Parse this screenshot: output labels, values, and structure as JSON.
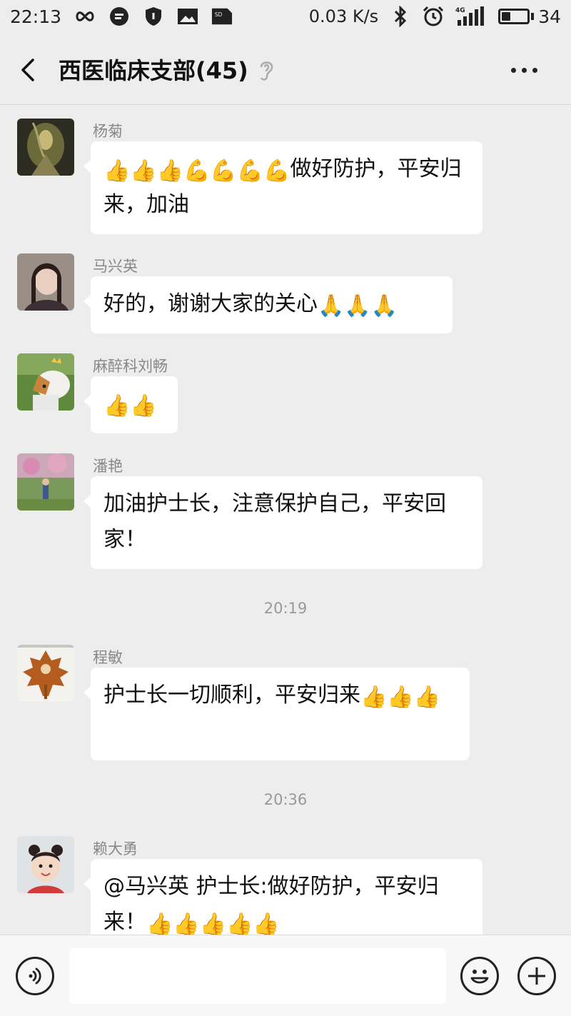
{
  "status_bar": {
    "time": "22:13",
    "network_speed": "0.03 K/s",
    "signal_type": "4G",
    "battery_level": "34",
    "battery_fraction": 0.34,
    "icons": [
      "infinity-icon",
      "message-icon",
      "shield-icon",
      "image-icon",
      "sd-card-icon",
      "bluetooth-icon",
      "alarm-icon",
      "signal-icon",
      "battery-icon"
    ]
  },
  "header": {
    "title": "西医临床支部(45)",
    "back_icon": "chevron-left-icon",
    "mute_icon": "ear-icon",
    "more_icon": "more-dots-icon"
  },
  "messages": [
    {
      "sender": "杨菊",
      "emoji_prefix": "👍👍👍💪💪💪💪",
      "text": "做好防护，平安归来，加油",
      "emoji_suffix": ""
    },
    {
      "sender": "马兴英",
      "emoji_prefix": "",
      "text": "好的，谢谢大家的关心",
      "emoji_suffix": "🙏🙏🙏"
    },
    {
      "sender": "麻醉科刘畅",
      "emoji_prefix": "👍👍",
      "text": "",
      "emoji_suffix": ""
    },
    {
      "sender": "潘艳",
      "emoji_prefix": "",
      "text": "加油护士长，注意保护自己，平安回家！",
      "emoji_suffix": ""
    },
    {
      "sender": "程敏",
      "emoji_prefix": "",
      "text": "护士长一切顺利，平安归来",
      "emoji_suffix": "👍👍👍"
    },
    {
      "sender": "赖大勇",
      "emoji_prefix": "",
      "text": "@马兴英  护士长:做好防护，平安归来！",
      "emoji_suffix": "👍👍👍👍👍"
    }
  ],
  "timestamps": [
    "20:19",
    "20:36"
  ],
  "input_bar": {
    "voice_icon": "voice-icon",
    "emoji_icon": "emoji-icon",
    "plus_icon": "plus-icon",
    "value": ""
  }
}
